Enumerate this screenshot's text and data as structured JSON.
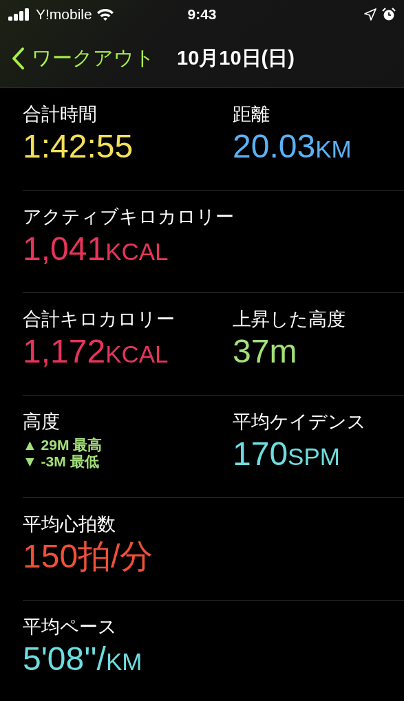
{
  "status_bar": {
    "carrier": "Y!mobile",
    "time": "9:43"
  },
  "nav": {
    "back_label": "ワークアウト",
    "title": "10月10日(日)"
  },
  "rows": [
    {
      "cells": [
        {
          "kind": "metric",
          "label": "合計時間",
          "value": "1:42:55",
          "color": "#f6e05a"
        },
        {
          "kind": "metric",
          "label": "距離",
          "value": "20.03",
          "unit": "KM",
          "color": "#5ab2f5"
        }
      ]
    },
    {
      "cells": [
        {
          "kind": "metric",
          "label": "アクティブキロカロリー",
          "value": "1,041",
          "unit": "KCAL",
          "color": "#e8345a"
        }
      ]
    },
    {
      "cells": [
        {
          "kind": "metric",
          "label": "合計キロカロリー",
          "value": "1,172",
          "unit": "KCAL",
          "color": "#e8345a"
        },
        {
          "kind": "metric",
          "label": "上昇した高度",
          "value": "37m",
          "color": "#a3e07a"
        }
      ]
    },
    {
      "cells": [
        {
          "kind": "range",
          "label": "高度",
          "lines": [
            "▲ 29M 最高",
            "▼ -3M 最低"
          ],
          "color": "#a3e07a"
        },
        {
          "kind": "metric",
          "label": "平均ケイデンス",
          "value": "170",
          "unit": "SPM",
          "color": "#6ddde0"
        }
      ]
    },
    {
      "cells": [
        {
          "kind": "metric",
          "label": "平均心拍数",
          "value": "150拍/分",
          "color": "#f04f38"
        }
      ]
    },
    {
      "cells": [
        {
          "kind": "metric",
          "label": "平均ペース",
          "value": "5'08''/",
          "unit": "KM",
          "color": "#6ddde0"
        }
      ]
    }
  ]
}
